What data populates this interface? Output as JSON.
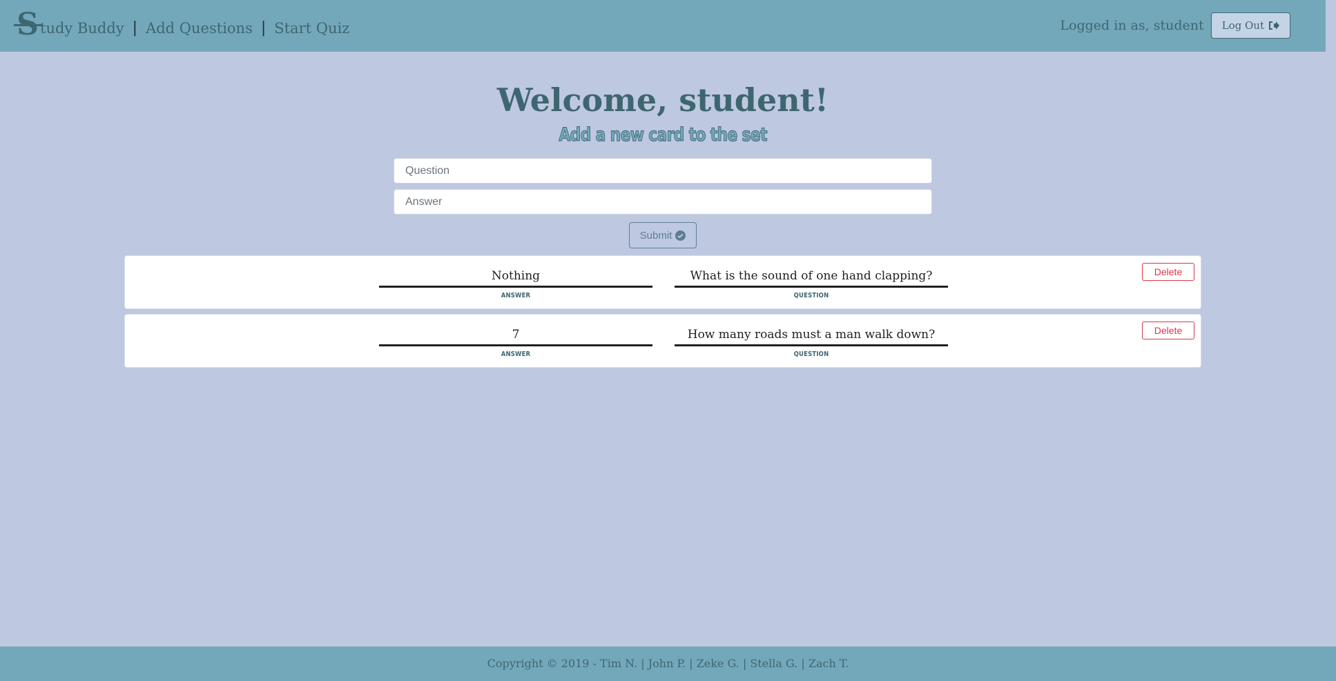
{
  "nav": {
    "brand": "Study Buddy",
    "logo_letter": "S",
    "separator": "|",
    "links": [
      "Add Questions",
      "Start Quiz"
    ],
    "logged_in_text": "Logged in as, student",
    "logout_label": "Log Out"
  },
  "main": {
    "welcome": "Welcome, student!",
    "subheading": "Add a new card to the set",
    "question_placeholder": "Question",
    "answer_placeholder": "Answer",
    "submit_label": "Submit"
  },
  "cards": [
    {
      "answer": "Nothing",
      "answer_label": "ANSWER",
      "question": "What is the sound of one hand clapping?",
      "question_label": "QUESTION",
      "delete_label": "Delete"
    },
    {
      "answer": "7",
      "answer_label": "ANSWER",
      "question": "How many roads must a man walk down?",
      "question_label": "QUESTION",
      "delete_label": "Delete"
    }
  ],
  "footer": {
    "text": "Copyright © 2019 - Tim N. | John P. | Zeke G. | Stella G. | Zach T."
  },
  "colors": {
    "page_bg": "#bfc8e1",
    "bar_bg": "#73a8bb",
    "text": "#3e6670",
    "danger": "#dc3545"
  },
  "icons": {
    "logout": "sign-out-icon",
    "submit": "check-circle-icon"
  }
}
